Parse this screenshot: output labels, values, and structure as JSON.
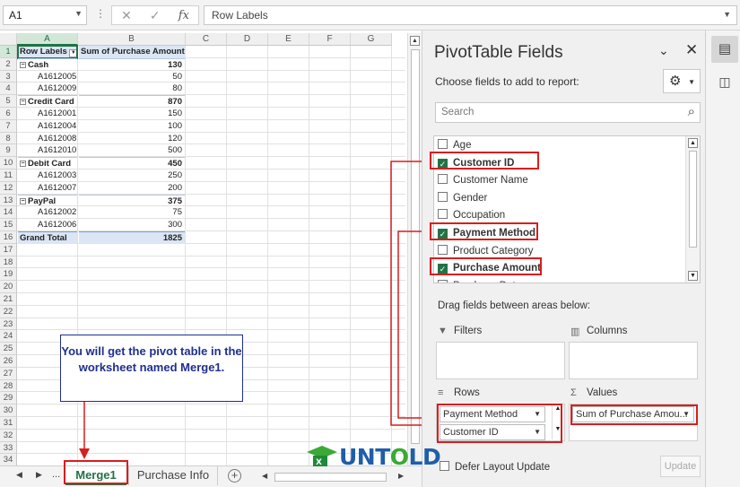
{
  "formula_bar": {
    "name_box": "A1",
    "formula": "Row Labels",
    "cancel_icon": "✕",
    "enter_icon": "✓",
    "fx_label": "fx"
  },
  "sheet": {
    "columns": [
      "A",
      "B",
      "C",
      "D",
      "E",
      "F",
      "G"
    ],
    "rows": [
      {
        "n": "1",
        "a": "Row Labels",
        "b": "Sum of Purchase Amount",
        "type": "header"
      },
      {
        "n": "2",
        "a": "Cash",
        "b": "130",
        "type": "group"
      },
      {
        "n": "3",
        "a": "A1612005",
        "b": "50",
        "type": "item"
      },
      {
        "n": "4",
        "a": "A1612009",
        "b": "80",
        "type": "item"
      },
      {
        "n": "5",
        "a": "Credit Card",
        "b": "870",
        "type": "group"
      },
      {
        "n": "6",
        "a": "A1612001",
        "b": "150",
        "type": "item"
      },
      {
        "n": "7",
        "a": "A1612004",
        "b": "100",
        "type": "item"
      },
      {
        "n": "8",
        "a": "A1612008",
        "b": "120",
        "type": "item"
      },
      {
        "n": "9",
        "a": "A1612010",
        "b": "500",
        "type": "item"
      },
      {
        "n": "10",
        "a": "Debit Card",
        "b": "450",
        "type": "group"
      },
      {
        "n": "11",
        "a": "A1612003",
        "b": "250",
        "type": "item"
      },
      {
        "n": "12",
        "a": "A1612007",
        "b": "200",
        "type": "item"
      },
      {
        "n": "13",
        "a": "PayPal",
        "b": "375",
        "type": "group"
      },
      {
        "n": "14",
        "a": "A1612002",
        "b": "75",
        "type": "item"
      },
      {
        "n": "15",
        "a": "A1612006",
        "b": "300",
        "type": "item"
      },
      {
        "n": "16",
        "a": "Grand Total",
        "b": "1825",
        "type": "total"
      },
      {
        "n": "17"
      },
      {
        "n": "18"
      },
      {
        "n": "19"
      },
      {
        "n": "20"
      },
      {
        "n": "21"
      },
      {
        "n": "22"
      },
      {
        "n": "23"
      },
      {
        "n": "24"
      },
      {
        "n": "25"
      },
      {
        "n": "26"
      },
      {
        "n": "27"
      },
      {
        "n": "28"
      },
      {
        "n": "29"
      },
      {
        "n": "30"
      },
      {
        "n": "31"
      },
      {
        "n": "32"
      },
      {
        "n": "33"
      },
      {
        "n": "34"
      }
    ]
  },
  "sheet_tabs": {
    "active": "Merge1",
    "other": "Purchase Info",
    "ellipsis": "...",
    "add": "+"
  },
  "callout": {
    "text": "You will get the pivot table in the worksheet named Merge1."
  },
  "pivot_panel": {
    "title": "PivotTable Fields",
    "subtitle": "Choose fields to add to report:",
    "search_placeholder": "Search",
    "fields": [
      {
        "label": "Age",
        "checked": false
      },
      {
        "label": "Customer ID",
        "checked": true
      },
      {
        "label": "Customer Name",
        "checked": false
      },
      {
        "label": "Gender",
        "checked": false
      },
      {
        "label": "Occupation",
        "checked": false
      },
      {
        "label": "Payment Method",
        "checked": true
      },
      {
        "label": "Product Category",
        "checked": false
      },
      {
        "label": "Purchase Amount",
        "checked": true
      },
      {
        "label": "Purchase Date",
        "checked": false
      }
    ],
    "drag_label": "Drag fields between areas below:",
    "areas": {
      "filters": "Filters",
      "columns": "Columns",
      "rows": "Rows",
      "values": "Values",
      "rows_items": [
        "Payment Method",
        "Customer ID"
      ],
      "values_items": [
        "Sum of Purchase Amou..."
      ]
    },
    "defer_label": "Defer Layout Update",
    "update_label": "Update"
  },
  "logo": {
    "text_before": "UNT",
    "text_o": "O",
    "text_after": "LD"
  },
  "colors": {
    "accent": "#217346",
    "annotation_red": "#d81e1e",
    "callout_blue": "#1f2f8f",
    "pivot_header_fill": "#dbe6f4"
  }
}
